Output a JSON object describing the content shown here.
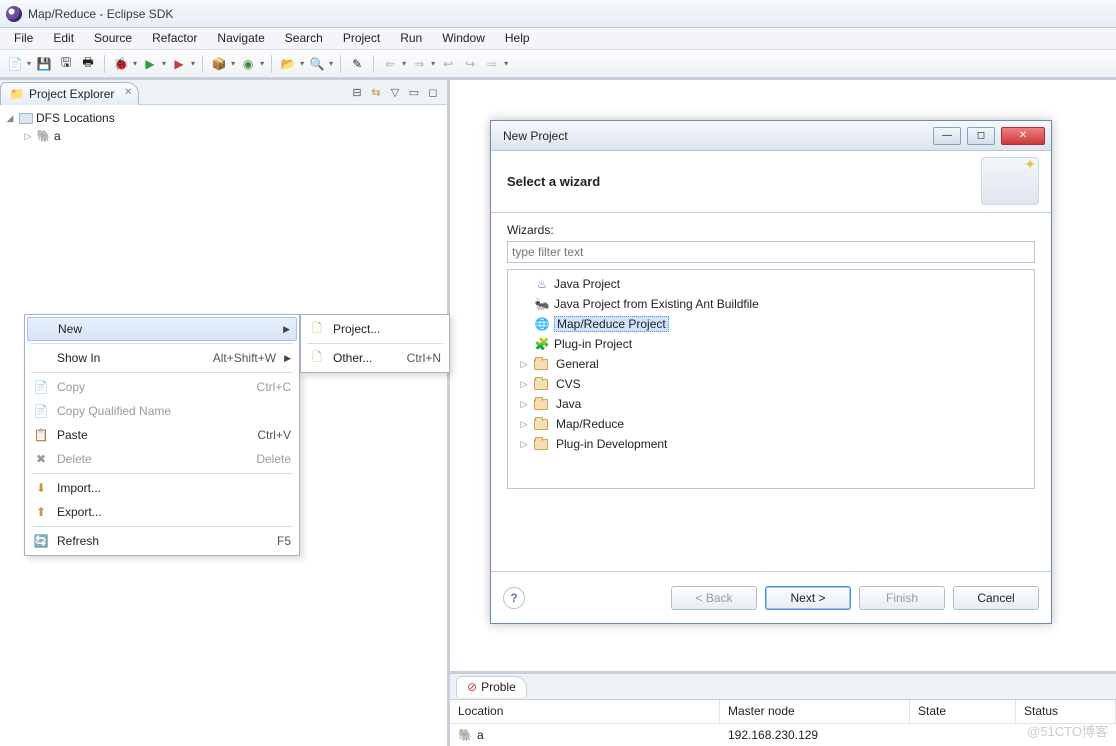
{
  "window": {
    "title": "Map/Reduce - Eclipse SDK"
  },
  "menu": [
    "File",
    "Edit",
    "Source",
    "Refactor",
    "Navigate",
    "Search",
    "Project",
    "Run",
    "Window",
    "Help"
  ],
  "explorer": {
    "title": "Project Explorer",
    "root": "DFS Locations",
    "child": "a"
  },
  "context": {
    "new": "New",
    "showin": "Show In",
    "showin_sc": "Alt+Shift+W",
    "copy": "Copy",
    "copy_sc": "Ctrl+C",
    "cqn": "Copy Qualified Name",
    "paste": "Paste",
    "paste_sc": "Ctrl+V",
    "delete": "Delete",
    "delete_sc": "Delete",
    "import": "Import...",
    "export": "Export...",
    "refresh": "Refresh",
    "refresh_sc": "F5",
    "sub_project": "Project...",
    "sub_other": "Other...",
    "sub_other_sc": "Ctrl+N"
  },
  "dialog": {
    "title": "New Project",
    "heading": "Select a wizard",
    "wizards_label": "Wizards:",
    "filter_placeholder": "type filter text",
    "items": {
      "java": "Java Project",
      "ant": "Java Project from Existing Ant Buildfile",
      "mr": "Map/Reduce Project",
      "plugin": "Plug-in Project",
      "general": "General",
      "cvs": "CVS",
      "javaf": "Java",
      "mrf": "Map/Reduce",
      "pid": "Plug-in Development"
    },
    "buttons": {
      "back": "< Back",
      "next": "Next >",
      "finish": "Finish",
      "cancel": "Cancel"
    }
  },
  "table": {
    "tab": "Proble",
    "cols": {
      "loc": "Location",
      "master": "Master node",
      "state": "State",
      "status": "Status"
    },
    "row": {
      "loc": "a",
      "master": "192.168.230.129"
    }
  },
  "watermark": "@51CTO博客"
}
